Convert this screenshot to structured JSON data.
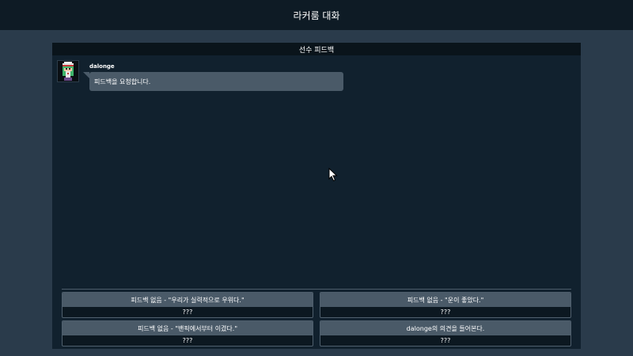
{
  "window": {
    "title": "라커룸 대화"
  },
  "panel": {
    "title": "선수 피드백"
  },
  "messages": [
    {
      "user": "dalonge",
      "text": "피드백을 요청합니다."
    }
  ],
  "options": [
    {
      "label": "피드백 없음 - \"우리가 실력적으로 우위다.\"",
      "sub": "???"
    },
    {
      "label": "피드백 없음 - \"운이 좋았다.\"",
      "sub": "???"
    },
    {
      "label": "피드백 없음 - \"밴픽에서부터 이겼다.\"",
      "sub": "???"
    },
    {
      "label": "dalonge의 의견을 들어본다.",
      "sub": "???"
    }
  ],
  "icons": {
    "avatar": "pixel-character-avatar-icon",
    "cursor": "mouse-pointer-icon"
  },
  "colors": {
    "background": "#2a3b4b",
    "panel": "#11212e",
    "bubble": "#4a5a68",
    "topbar": "#0e1b25"
  }
}
